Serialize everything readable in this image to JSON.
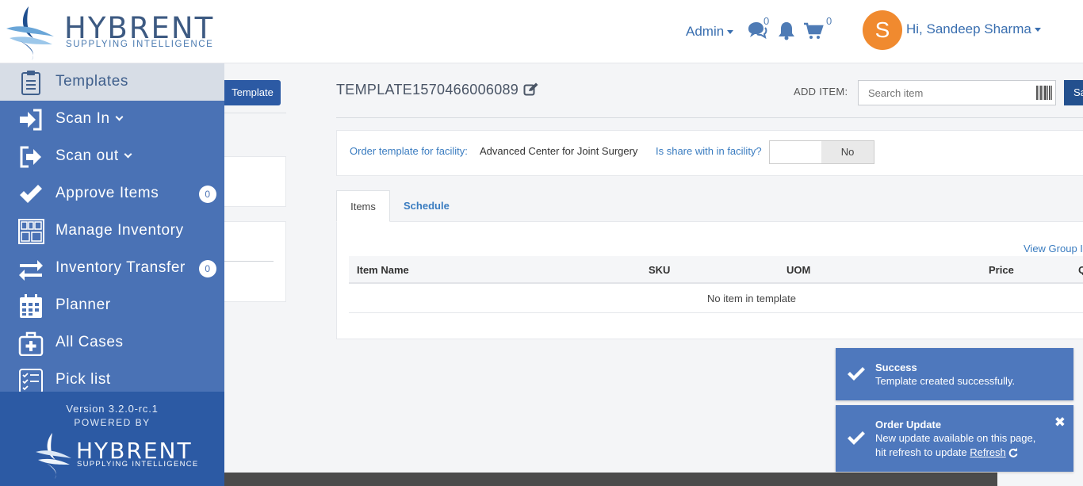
{
  "header": {
    "logo_word": "HYBRENT",
    "logo_tagline": "SUPPLYING INTELLIGENCE",
    "admin_label": "Admin",
    "messages_count": "0",
    "cart_count": "0",
    "avatar_letter": "S",
    "greeting": "Hi, Sandeep Sharma"
  },
  "sidebar": {
    "items": [
      {
        "label": "Templates",
        "icon": "clipboard-icon"
      },
      {
        "label": "Scan In",
        "icon": "sign-in-icon"
      },
      {
        "label": "Scan out",
        "icon": "sign-out-icon"
      },
      {
        "label": "Approve Items",
        "icon": "check-icon",
        "badge": "0"
      },
      {
        "label": "Manage Inventory",
        "icon": "inventory-shelves-icon"
      },
      {
        "label": "Inventory Transfer",
        "icon": "exchange-arrows-icon",
        "badge": "0"
      },
      {
        "label": "Planner",
        "icon": "calendar-icon"
      },
      {
        "label": "All Cases",
        "icon": "medical-case-icon"
      },
      {
        "label": "Pick list",
        "icon": "checklist-icon"
      }
    ],
    "version": "Version 3.2.0-rc.1",
    "powered_by": "POWERED BY",
    "footer_logo_word": "HYBRENT",
    "footer_logo_tagline": "SUPPLYING INTELLIGENCE"
  },
  "left_panel": {
    "new_template_label": "Template"
  },
  "main": {
    "template_title": "TEMPLATE1570466006089",
    "add_item_label": "ADD ITEM:",
    "search_placeholder": "Search item",
    "save_label": "Sa",
    "facility_label": "Order template for facility:",
    "facility_value": "Advanced Center for Joint Surgery",
    "share_label": "Is share with in facility?",
    "share_value": "No",
    "tabs": [
      {
        "label": "Items"
      },
      {
        "label": "Schedule"
      }
    ],
    "view_group_label": "View Group I",
    "table_headers": [
      "Item Name",
      "SKU",
      "UOM",
      "Price",
      "Q"
    ],
    "empty_message": "No item in template"
  },
  "toasts": [
    {
      "title": "Success",
      "message": "Template created successfully."
    },
    {
      "title": "Order Update",
      "message_line1": "New update available on this page,",
      "message_line2": "hit refresh to update",
      "link": "Refresh"
    }
  ],
  "colors": {
    "sidebar_bg": "#4a72b5",
    "sidebar_active_bg": "#d7dde6",
    "primary": "#2c5aa4",
    "link": "#3a7cc0",
    "avatar": "#f08a2f",
    "toast_bg": "#4e78bd"
  }
}
